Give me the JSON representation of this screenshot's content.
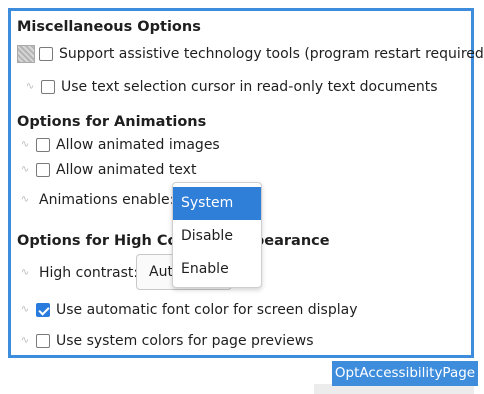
{
  "sections": {
    "misc": {
      "title": "Miscellaneous Options",
      "assistive_label": "Support assistive technology tools (program restart required)",
      "selection_cursor_label": "Use text selection cursor in read-only text documents"
    },
    "animations": {
      "title": "Options for Animations",
      "animated_images_label": "Allow animated images",
      "animated_text_label": "Allow animated text",
      "enable_label": "Animations enable:"
    },
    "high_contrast": {
      "title": "Options for High Contrast Appearance",
      "contrast_label": "High contrast:",
      "contrast_value": "Automatic",
      "auto_font_color_label": "Use automatic font color for screen display",
      "system_colors_label": "Use system colors for page previews"
    }
  },
  "dropdown": {
    "options": [
      "System",
      "Disable",
      "Enable"
    ],
    "selected": "System"
  },
  "checkbox_states": {
    "assistive": false,
    "selection_cursor": false,
    "animated_images": false,
    "animated_text": false,
    "auto_font_color": true,
    "system_colors": false
  },
  "caption": "OptAccessibilityPage",
  "colors": {
    "accent": "#3e8ddd",
    "selection": "#2f7fd8",
    "checkbox_checked": "#2a7bde"
  },
  "icons": {
    "locked": "lock-icon",
    "hatched": "hatched-square-icon",
    "check": "checkmark-icon"
  }
}
